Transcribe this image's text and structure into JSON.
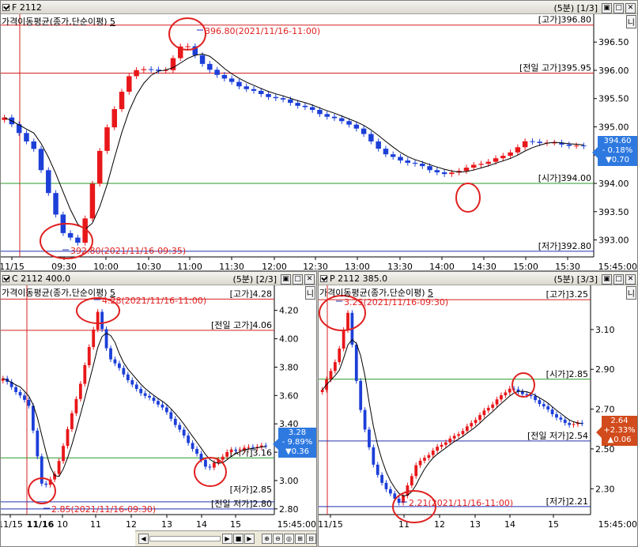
{
  "top": {
    "title": "F 2112",
    "menu": "(5분) [1/3]",
    "indicator": "가격이동평균(종가,단순이평)",
    "indicator_period": "5",
    "nl_label": "니",
    "price_box": {
      "price": "394.60",
      "change_pct": "- 0.18%",
      "change": "▼0.70",
      "color": "#2e79e0"
    },
    "ref_labels": {
      "high": "[고가]396.80",
      "prev_high": "[전일 고가]395.95",
      "open": "[시가]394.00",
      "low": "[저가]392.80"
    },
    "annot_high": "396.80(2021/11/16-11:00)",
    "annot_low": "392.80(2021/11/16-09:35)",
    "y_ticks": [
      "396.50",
      "396.00",
      "395.50",
      "395.00",
      "394.50",
      "394.00",
      "393.50",
      "393.00"
    ],
    "x_ticks": [
      "11/15",
      "09:30",
      "10:00",
      "10:30",
      "11:00",
      "11:30",
      "12:00",
      "12:30",
      "13:00",
      "13:30",
      "14:00",
      "14:30",
      "15:00",
      "15:30"
    ],
    "x_end": "15:45:00"
  },
  "call": {
    "title": "C 2112 400.0",
    "menu": "(5분) [2/3]",
    "indicator": "가격이동평균(종가,단순이평)",
    "indicator_period": "5",
    "nl_label": "니",
    "price_box": {
      "price": "3.28",
      "change_pct": "- 9.89%",
      "change": "▼0.36",
      "color": "#2e79e0"
    },
    "ref_labels": {
      "high": "[고가]4.28",
      "prev_high": "[전일 고가]4.06",
      "open": "[시가]3.16",
      "low": "[저가]2.85",
      "prev_low": "[전일 저가]2.80"
    },
    "annot_high": "4.28(2021/11/16-11:00)",
    "annot_low": "2.85(2021/11/16-09:30)",
    "y_ticks": [
      "4.20",
      "4.00",
      "3.80",
      "3.60",
      "3.40",
      "3.20",
      "3.00",
      "2.80"
    ],
    "x_ticks": [
      "11/15",
      "11/16",
      "10",
      "11",
      "12",
      "13",
      "14",
      "15"
    ],
    "x_end": "15:45:00"
  },
  "put": {
    "title": "P 2112 385.0",
    "menu": "(5분) [3/3]",
    "indicator": "가격이동평균(종가,단순이평)",
    "indicator_period": "5",
    "nl_label": "니",
    "price_box": {
      "price": "2.64",
      "change_pct": "+2.33%",
      "change": "▲0.06",
      "color": "#d24b1c"
    },
    "ref_labels": {
      "high": "[고가]3.25",
      "open": "[시가]2.85",
      "prev_low": "[전일 저가]2.54",
      "low": "[저가]2.21"
    },
    "annot_high": "3.25(2021/11/16-09:30)",
    "annot_low": "2.21(2021/11/16-11:00)",
    "y_ticks": [
      "3.10",
      "2.90",
      "2.70",
      "2.50",
      "2.30"
    ],
    "x_ticks": [
      "11/15",
      "11",
      "12",
      "13",
      "14",
      "15"
    ],
    "x_end": "15:45:00"
  },
  "colors": {
    "up": "#e8171a",
    "down": "#1c3fd8",
    "ref_red": "#d42020",
    "ref_green": "#2a9a2a",
    "ref_blue": "#2030b0",
    "annot": "#e02020"
  }
}
